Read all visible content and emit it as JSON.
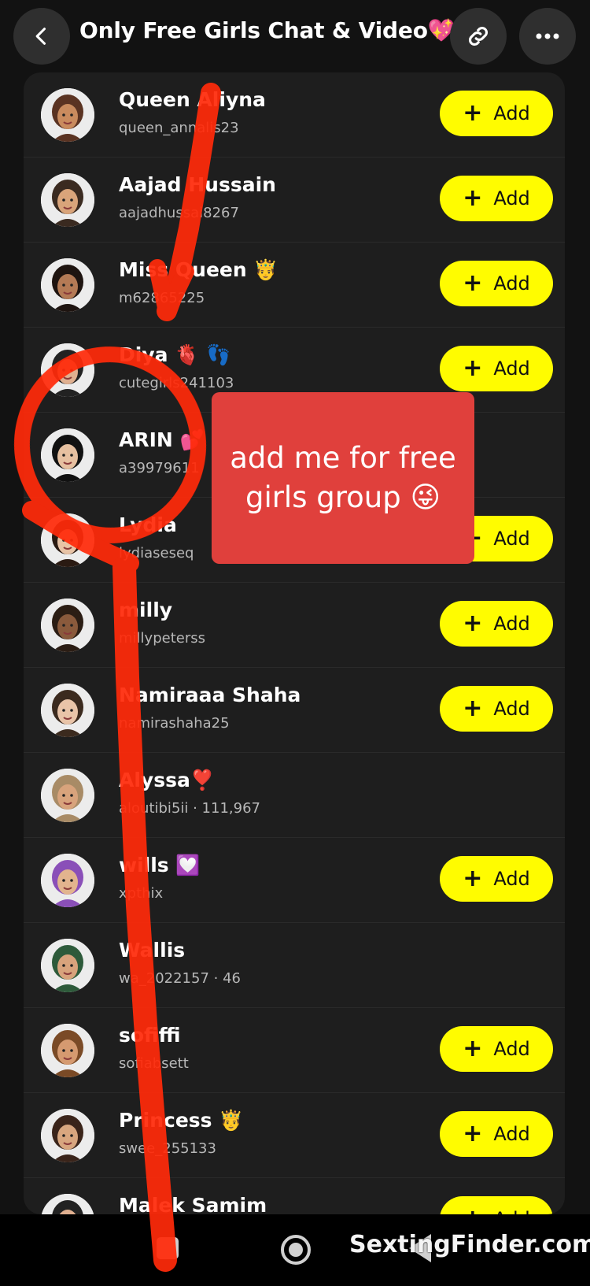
{
  "header": {
    "title": "Only Free Girls Chat & Video💖",
    "back_icon": "chevron-left-icon",
    "link_icon": "link-icon",
    "more_icon": "more-horizontal-icon"
  },
  "add_label": "Add",
  "members": [
    {
      "name": "Queen Aliyna",
      "username": "queen_annalis23",
      "add": true,
      "skin": "#c98b5e",
      "hair": "#5a3322"
    },
    {
      "name": "Aajad Hussain",
      "username": "aajadhussai8267",
      "add": true,
      "skin": "#d9a47a",
      "hair": "#3a2a20"
    },
    {
      "name": "Miss Queen 🤴",
      "username": "m62865225",
      "add": true,
      "skin": "#b47a55",
      "hair": "#1e1410"
    },
    {
      "name": "Diya 🫀 👣",
      "username": "cutegirls241103",
      "add": true,
      "skin": "#e0b090",
      "hair": "#222222"
    },
    {
      "name": "ARIN 💕",
      "username": "a39979611",
      "add": false,
      "skin": "#e6c0a0",
      "hair": "#111111"
    },
    {
      "name": "Lydia",
      "username": "lydiaseseq",
      "add": true,
      "skin": "#e8c3a6",
      "hair": "#2a1a12"
    },
    {
      "name": "milly",
      "username": "millypeterss",
      "add": true,
      "skin": "#8a5a3c",
      "hair": "#2b1d14"
    },
    {
      "name": "Namiraaa Shaha",
      "username": "namirashaha25",
      "add": true,
      "skin": "#e9c4a8",
      "hair": "#3b2a1e"
    },
    {
      "name": "Alyssa❣️",
      "username": "aloutibi5ii · 111,967",
      "add": false,
      "skin": "#d8a37c",
      "hair": "#a88b66"
    },
    {
      "name": "wills 💟",
      "username": "xpthix",
      "add": true,
      "skin": "#e2b48e",
      "hair": "#8a4fb8"
    },
    {
      "name": "Wallis",
      "username": "wa_2022157 · 46",
      "add": false,
      "skin": "#d8a37c",
      "hair": "#2d5a3a"
    },
    {
      "name": "sofiffi",
      "username": "sofiabsett",
      "add": true,
      "skin": "#d59a70",
      "hair": "#7a4a26"
    },
    {
      "name": "Princess 🤴",
      "username": "swee_255133",
      "add": true,
      "skin": "#d8a67f",
      "hair": "#3a241a"
    },
    {
      "name": "Malek Samim",
      "username": "",
      "add": true,
      "skin": "#e0b090",
      "hair": "#222222"
    }
  ],
  "overlay_note": "add me for free girls group 😜",
  "watermark": "SextingFinder.com",
  "colors": {
    "background": "#121212",
    "card": "#1e1e1e",
    "add_button": "#fffc00",
    "annotation_red": "#e0403c",
    "scribble_red": "#ff2a0a"
  }
}
